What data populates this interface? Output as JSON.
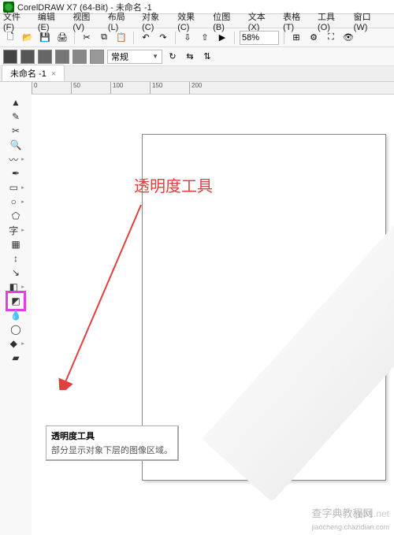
{
  "title": "CorelDRAW X7 (64-Bit) - 未命名 -1",
  "menu": [
    "文件(F)",
    "编辑(E)",
    "视图(V)",
    "布局(L)",
    "对象(C)",
    "效果(C)",
    "位图(B)",
    "文本(X)",
    "表格(T)",
    "工具(O)",
    "窗口(W)"
  ],
  "zoom": "58%",
  "style_dropdown": "常规",
  "tab": {
    "label": "未命名 -1",
    "close": "×"
  },
  "ruler_ticks": [
    "0",
    "50",
    "100",
    "150",
    "200"
  ],
  "annotation": "透明度工具",
  "tooltip": {
    "title": "透明度工具",
    "body": "部分显示对象下层的图像区域。"
  },
  "watermark_top": ".jb51.net",
  "watermark_main": "查字典教程网",
  "watermark_sub": "jiaocheng.chazidian.com",
  "icons": {
    "new": "🗋",
    "open": "📂",
    "save": "💾",
    "print": "🖨",
    "cut": "✂",
    "copy": "⧉",
    "paste": "📋",
    "undo": "↶",
    "redo": "↷",
    "import": "⇩",
    "export": "⇧",
    "launch": "▶",
    "snap": "⊞",
    "options": "⚙",
    "full": "⛶",
    "view": "👁"
  },
  "toolbox": [
    "pick-tool",
    "shape-tool",
    "crop-tool",
    "zoom-tool",
    "freehand-tool",
    "artistic-media-tool",
    "rectangle-tool",
    "ellipse-tool",
    "polygon-tool",
    "text-tool",
    "table-tool",
    "dimension-tool",
    "connector-tool",
    "dropshadow-tool",
    "transparency-tool",
    "eyedropper-tool",
    "outline-tool",
    "fill-tool",
    "interactive-fill-tool"
  ],
  "tool_glyphs": {
    "pick-tool": "▲",
    "shape-tool": "✎",
    "crop-tool": "✂",
    "zoom-tool": "🔍",
    "freehand-tool": "〰",
    "artistic-media-tool": "✒",
    "rectangle-tool": "▭",
    "ellipse-tool": "○",
    "polygon-tool": "⬠",
    "text-tool": "字",
    "table-tool": "▦",
    "dimension-tool": "↕",
    "connector-tool": "↘",
    "dropshadow-tool": "◧",
    "transparency-tool": "◩",
    "eyedropper-tool": "💧",
    "outline-tool": "◯",
    "fill-tool": "◆",
    "interactive-fill-tool": "▰"
  }
}
